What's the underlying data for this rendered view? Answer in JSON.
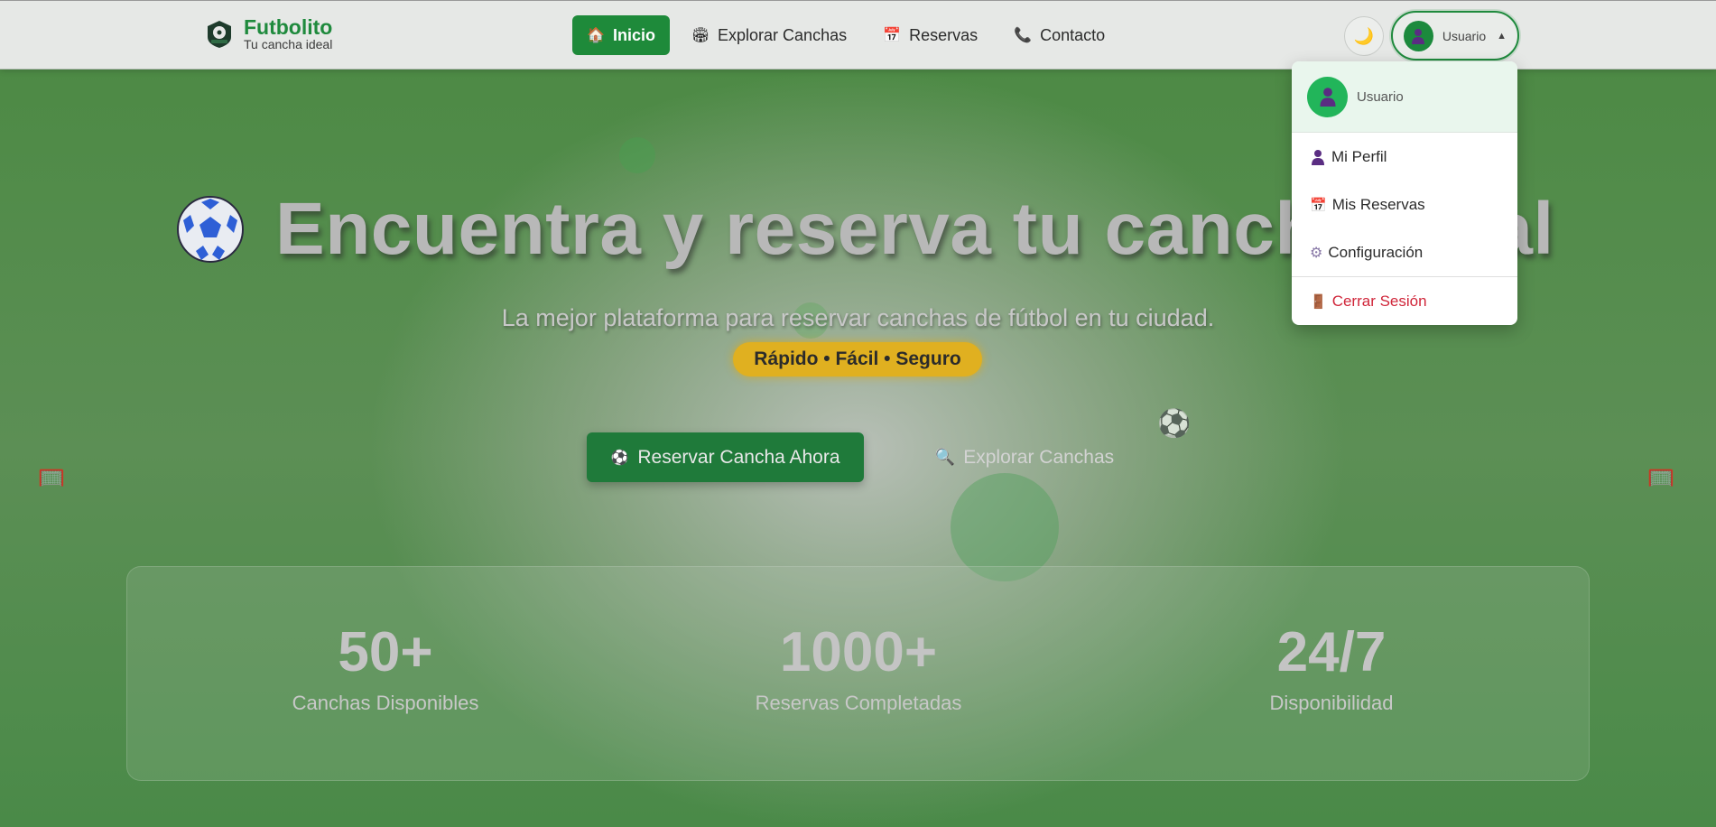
{
  "brand": {
    "name": "Futbolito",
    "tagline": "Tu cancha ideal"
  },
  "nav": {
    "items": [
      {
        "label": "Inicio",
        "icon": "home-icon",
        "active": true
      },
      {
        "label": "Explorar Canchas",
        "icon": "stadium-icon",
        "active": false
      },
      {
        "label": "Reservas",
        "icon": "calendar-icon",
        "active": false
      },
      {
        "label": "Contacto",
        "icon": "phone-icon",
        "active": false
      }
    ]
  },
  "theme_toggle": {
    "icon": "moon-icon"
  },
  "user_menu": {
    "label": "Usuario",
    "caret": "▲",
    "dropdown": {
      "header_name": "Usuario",
      "items": [
        {
          "label": "Mi Perfil",
          "icon": "user-icon"
        },
        {
          "label": "Mis Reservas",
          "icon": "calendar-icon"
        },
        {
          "label": "Configuración",
          "icon": "gear-icon"
        },
        {
          "label": "Cerrar Sesión",
          "icon": "door-icon"
        }
      ]
    }
  },
  "hero": {
    "title": "Encuentra y reserva tu cancha ideal",
    "subtitle": "La mejor plataforma para reservar canchas de fútbol en tu ciudad.",
    "badge": "Rápido • Fácil • Seguro",
    "primary_button": "Reservar Cancha Ahora",
    "secondary_button": "Explorar Canchas"
  },
  "stats": [
    {
      "value": "50+",
      "label": "Canchas Disponibles"
    },
    {
      "value": "1000+",
      "label": "Reservas Completadas"
    },
    {
      "value": "24/7",
      "label": "Disponibilidad"
    }
  ],
  "colors": {
    "brand_green": "#1f8a3d",
    "hero_green": "#4d8a45",
    "badge_yellow": "#e0b020",
    "danger": "#d0263a"
  }
}
